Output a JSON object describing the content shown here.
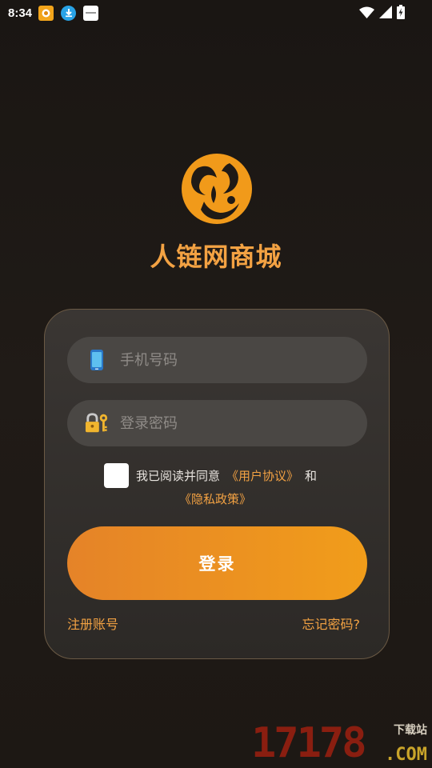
{
  "status_bar": {
    "time": "8:34"
  },
  "app": {
    "title": "人链网商城",
    "accent_color": "#f3a243",
    "logo_icon": "orange-swirl-logo"
  },
  "form": {
    "phone_placeholder": "手机号码",
    "phone_icon": "mobile-phone-icon",
    "password_placeholder": "登录密码",
    "password_icon": "lock-key-icon",
    "agree_text": "我已阅读并同意",
    "user_agreement": "《用户协议》",
    "and_text": "和",
    "privacy_policy": "《隐私政策》",
    "login_label": "登录",
    "register_label": "注册账号",
    "forgot_label": "忘记密码?"
  },
  "watermark": {
    "number": "17178",
    "tag": "下载站",
    "domain": ".COM"
  }
}
